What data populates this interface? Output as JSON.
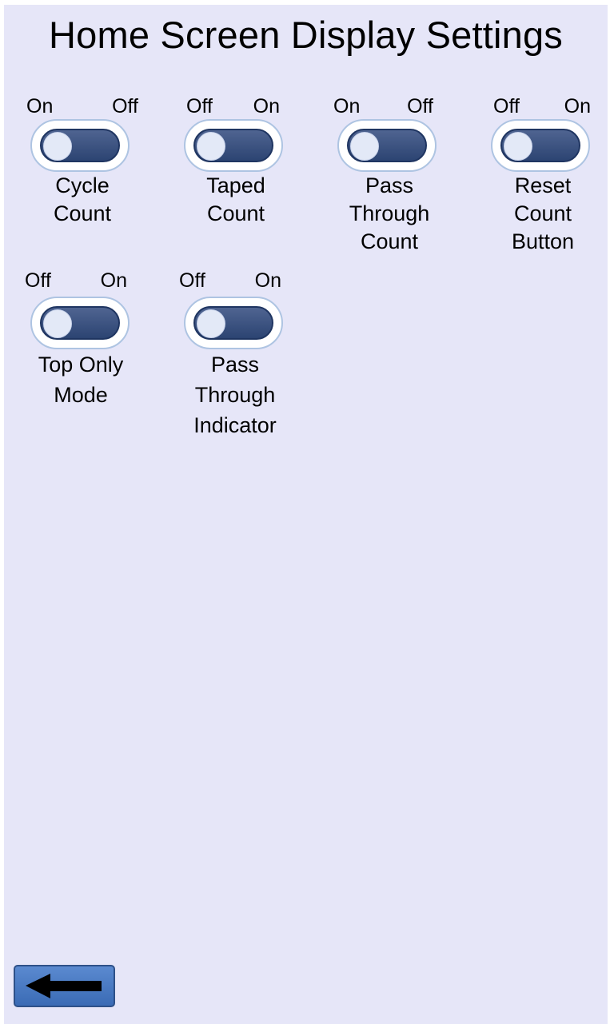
{
  "title": "Home Screen Display Settings",
  "toggles": [
    {
      "left_label": "On",
      "right_label": "Off",
      "name_lines": [
        "Cycle",
        "Count"
      ]
    },
    {
      "left_label": "Off",
      "right_label": "On",
      "name_lines": [
        "Taped",
        "Count"
      ]
    },
    {
      "left_label": "On",
      "right_label": "Off",
      "name_lines": [
        "Pass",
        "Through",
        "Count"
      ]
    },
    {
      "left_label": "Off",
      "right_label": "On",
      "name_lines": [
        "Reset",
        "Count",
        "Button"
      ]
    },
    {
      "left_label": "Off",
      "right_label": "On",
      "name_lines": [
        "Top Only",
        "Mode"
      ]
    },
    {
      "left_label": "Off",
      "right_label": "On",
      "name_lines": [
        "Pass",
        "Through",
        "Indicator"
      ]
    }
  ],
  "back_button": {
    "icon": "arrow-left-icon"
  },
  "colors": {
    "background": "#e6e6f8",
    "switch_track": "#2c4472",
    "switch_knob": "#e3e9f7",
    "back_button": "#4a7cc4"
  }
}
